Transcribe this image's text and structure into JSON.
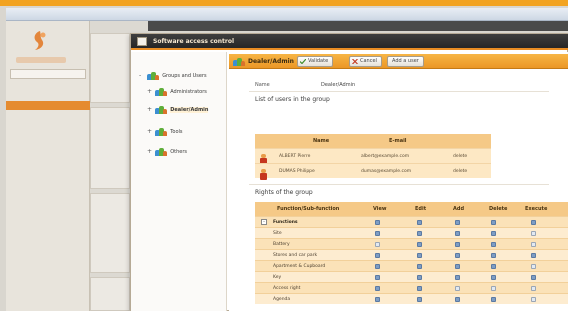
{
  "os_title": "",
  "app": {
    "nav": [
      "",
      "",
      "",
      "",
      "",
      ""
    ],
    "tabbar_text": ""
  },
  "dialog": {
    "title": "Software access control"
  },
  "tree": {
    "items": [
      {
        "label": "Groups and Users",
        "expander": "-"
      },
      {
        "label": "Administrators",
        "expander": "+"
      },
      {
        "label": "Dealer/Admin",
        "expander": "+"
      },
      {
        "label": "Tools",
        "expander": "+"
      },
      {
        "label": "Others",
        "expander": "+"
      }
    ]
  },
  "detail": {
    "toolbar_title": "Dealer/Admin",
    "buttons": {
      "validate": "Validate",
      "cancel": "Cancel",
      "add_user": "Add a user"
    },
    "name_label": "Name",
    "name_value": "Dealer/Admin",
    "users_section_title": "List of users in the group",
    "users_columns": {
      "name": "Name",
      "email": "E-mail"
    },
    "users": [
      {
        "name": "ALBERT Pierre",
        "email": "albert@example.com",
        "action": "delete"
      },
      {
        "name": "DUMAS Philippe",
        "email": "dumas@example.com",
        "action": "delete"
      }
    ],
    "rights_section_title": "Rights of the group",
    "rights_columns": [
      "Function/Sub-function",
      "View",
      "Edit",
      "Add",
      "Delete",
      "Execute"
    ],
    "rights": [
      {
        "name": "Functions",
        "bold": true,
        "expander": "-",
        "checks": [
          true,
          true,
          true,
          true,
          true
        ]
      },
      {
        "name": "Site",
        "bold": false,
        "checks": [
          true,
          true,
          true,
          true,
          false
        ]
      },
      {
        "name": "Battery",
        "bold": false,
        "checks": [
          false,
          true,
          true,
          true,
          false
        ]
      },
      {
        "name": "Stores and car park",
        "bold": false,
        "checks": [
          true,
          true,
          true,
          true,
          true
        ]
      },
      {
        "name": "Apartment & Cupboard",
        "bold": false,
        "checks": [
          true,
          true,
          true,
          true,
          false
        ]
      },
      {
        "name": "Key",
        "bold": false,
        "checks": [
          true,
          true,
          true,
          true,
          true
        ]
      },
      {
        "name": "Access right",
        "bold": false,
        "checks": [
          true,
          true,
          false,
          false,
          false
        ]
      },
      {
        "name": "Agenda",
        "bold": false,
        "checks": [
          true,
          true,
          true,
          true,
          false
        ]
      }
    ]
  },
  "colors": {
    "accent": "#e98d23",
    "toolbar": "#f2a533",
    "table_head": "#f5c987",
    "row": "#fde8c4"
  }
}
